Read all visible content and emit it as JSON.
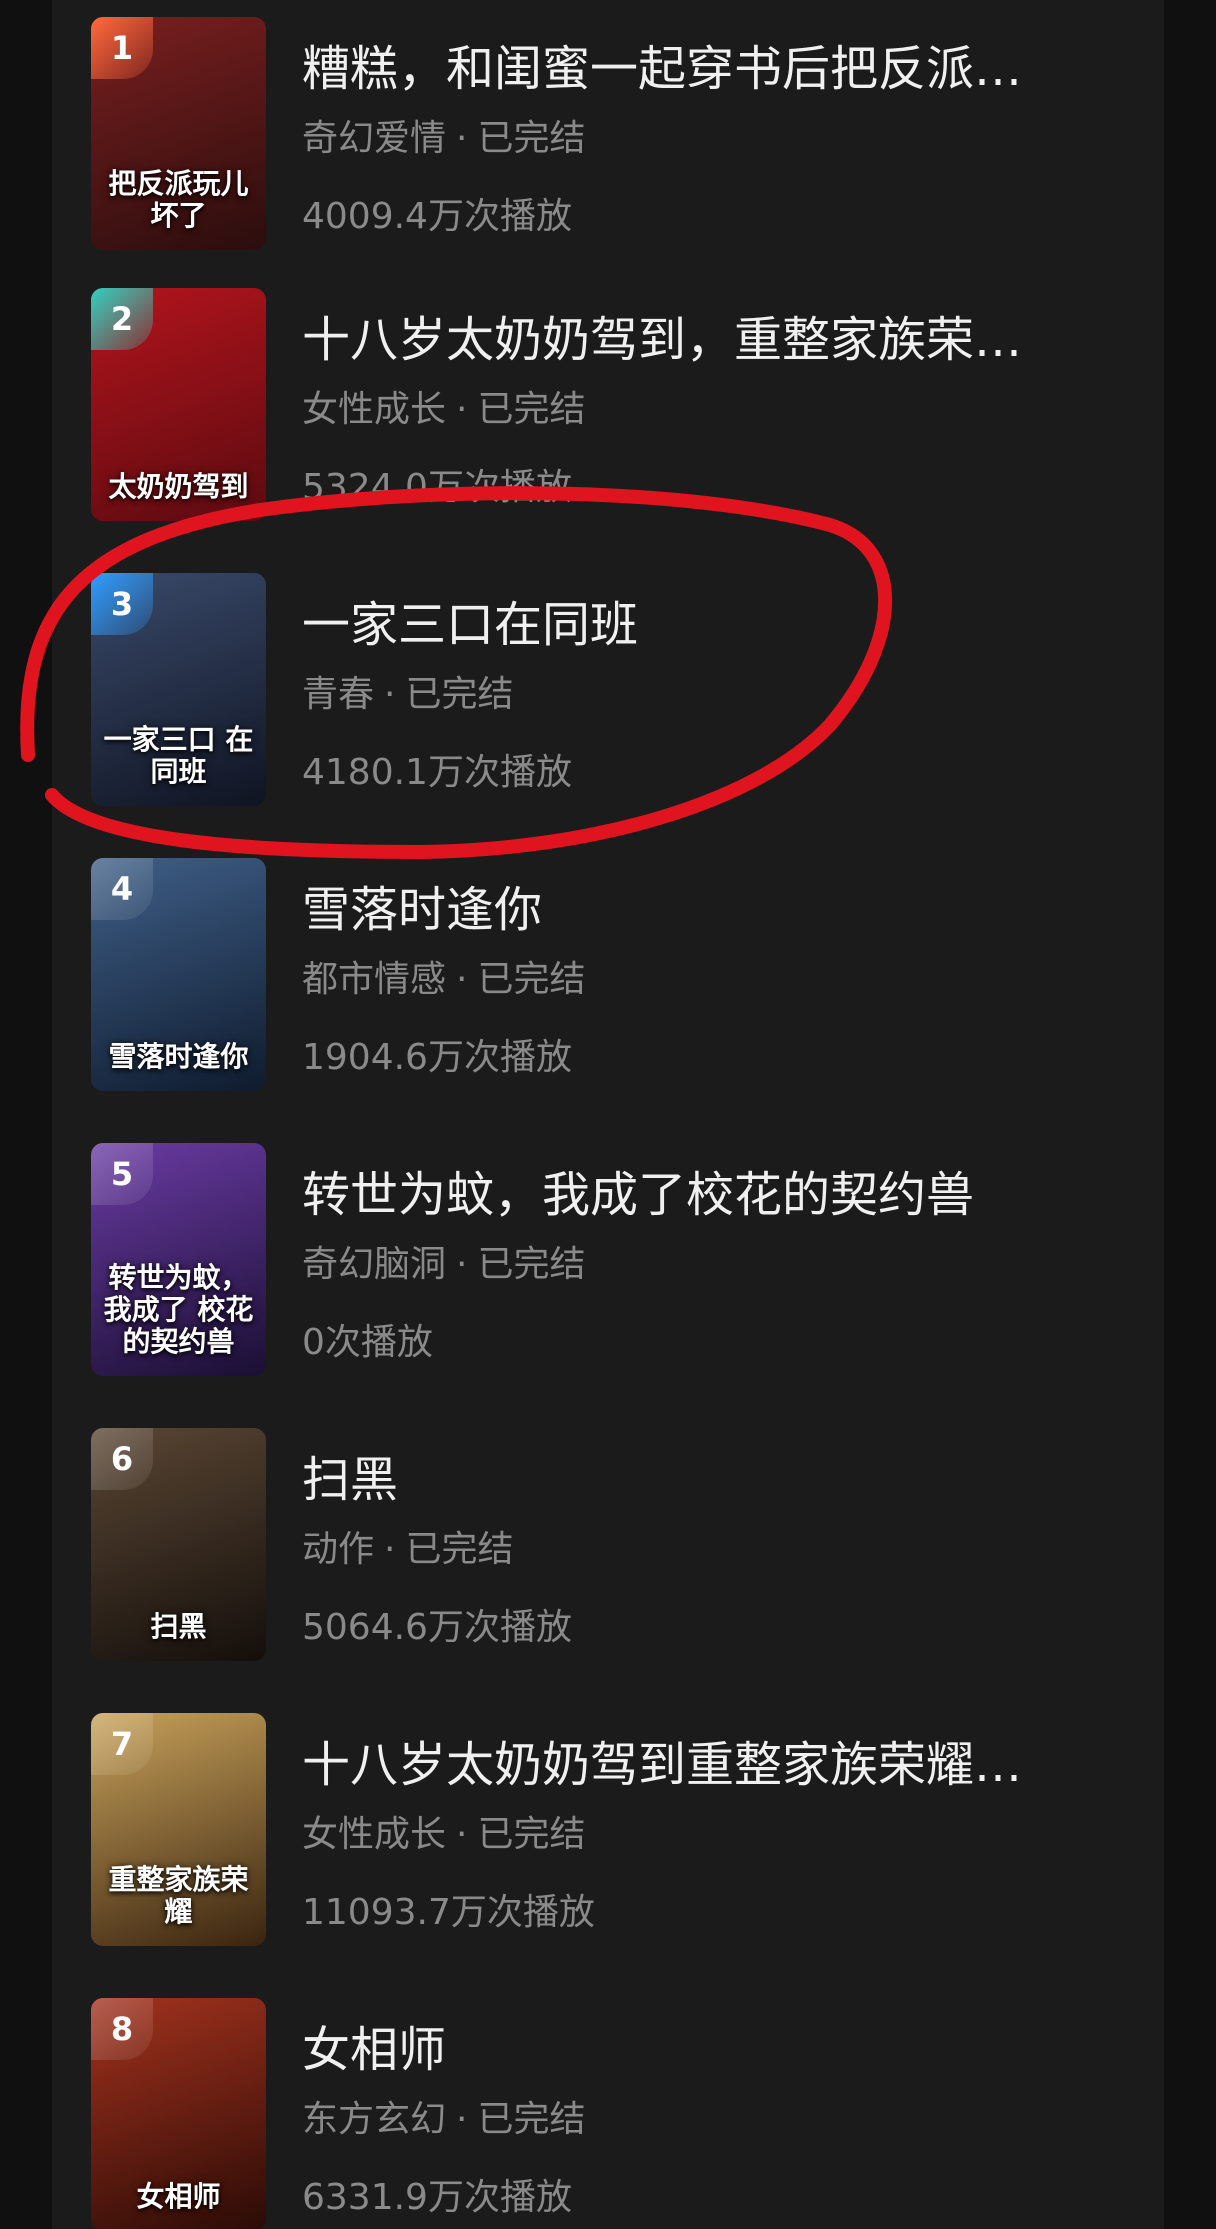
{
  "list": [
    {
      "rank": "1",
      "title": "糟糕，和闺蜜一起穿书后把反派…",
      "genre": "奇幻爱情",
      "status": "已完结",
      "plays": "4009.4万次播放",
      "poster_caption": "把反派玩儿坏了",
      "poster_colors": [
        "#7a1f1f",
        "#2b0d0d"
      ],
      "rank_class": "top1"
    },
    {
      "rank": "2",
      "title": "十八岁太奶奶驾到，重整家族荣…",
      "genre": "女性成长",
      "status": "已完结",
      "plays": "5324.0万次播放",
      "poster_caption": "太奶奶驾到",
      "poster_colors": [
        "#b3141c",
        "#5a0b10"
      ],
      "rank_class": "top2"
    },
    {
      "rank": "3",
      "title": "一家三口在同班",
      "genre": "青春",
      "status": "已完结",
      "plays": "4180.1万次播放",
      "poster_caption": "一家三口 在同班",
      "poster_colors": [
        "#3a4a6b",
        "#0f1422"
      ],
      "rank_class": "top3"
    },
    {
      "rank": "4",
      "title": "雪落时逢你",
      "genre": "都市情感",
      "status": "已完结",
      "plays": "1904.6万次播放",
      "poster_caption": "雪落时逢你",
      "poster_colors": [
        "#3f5f88",
        "#0f1b2e"
      ],
      "rank_class": ""
    },
    {
      "rank": "5",
      "title": "转世为蚊，我成了校花的契约兽",
      "genre": "奇幻脑洞",
      "status": "已完结",
      "plays": "0次播放",
      "poster_caption": "转世为蚊，我成了 校花的契约兽",
      "poster_colors": [
        "#6a3ba3",
        "#1a0f33"
      ],
      "rank_class": ""
    },
    {
      "rank": "6",
      "title": "扫黑",
      "genre": "动作",
      "status": "已完结",
      "plays": "5064.6万次播放",
      "poster_caption": "扫黑",
      "poster_colors": [
        "#5a4634",
        "#140f0b"
      ],
      "rank_class": ""
    },
    {
      "rank": "7",
      "title": "十八岁太奶奶驾到重整家族荣耀…",
      "genre": "女性成长",
      "status": "已完结",
      "plays": "11093.7万次播放",
      "poster_caption": "重整家族荣耀",
      "poster_colors": [
        "#c8a25a",
        "#3a2410"
      ],
      "rank_class": ""
    },
    {
      "rank": "8",
      "title": "女相师",
      "genre": "东方玄幻",
      "status": "已完结",
      "plays": "6331.9万次播放",
      "poster_caption": "女相师",
      "poster_colors": [
        "#a3321d",
        "#2a0b06"
      ],
      "rank_class": ""
    }
  ],
  "annotation_color": "#e0141f"
}
